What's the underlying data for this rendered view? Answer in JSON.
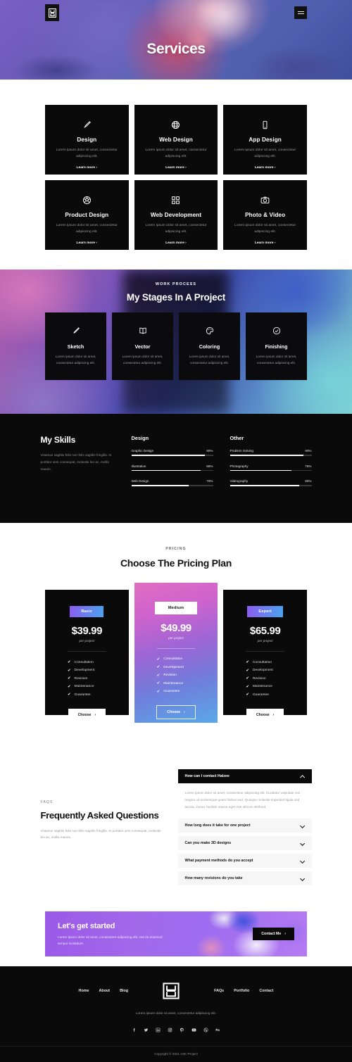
{
  "brand": {
    "name": "Halzee",
    "logo_icon": "h-monogram-logo"
  },
  "hero": {
    "title": "Services",
    "menu_icon": "hamburger-menu-icon"
  },
  "services": {
    "cards": [
      {
        "icon": "brush-icon",
        "title": "Design",
        "desc": "Lorem ipsum dolor sit amet, consectetur adipiscing elit.",
        "link": "Learn more"
      },
      {
        "icon": "globe-icon",
        "title": "Web Design",
        "desc": "Lorem ipsum dolor sit amet, consectetur adipiscing elit.",
        "link": "Learn more"
      },
      {
        "icon": "mobile-icon",
        "title": "App Design",
        "desc": "Lorem ipsum dolor sit amet, consectetur adipiscing elit.",
        "link": "Learn more"
      },
      {
        "icon": "soccer-ball-icon",
        "title": "Product Design",
        "desc": "Lorem ipsum dolor sit amet, consectetur adipiscing elit.",
        "link": "Learn more"
      },
      {
        "icon": "grid-squares-icon",
        "title": "Web Development",
        "desc": "Lorem ipsum dolor sit amet, consectetur adipiscing elit.",
        "link": "Learn more"
      },
      {
        "icon": "camera-icon",
        "title": "Photo & Video",
        "desc": "Lorem ipsum dolor sit amet, consectetur adipiscing elit.",
        "link": "Learn more"
      }
    ]
  },
  "process": {
    "label": "WORK PROCESS",
    "title": "My Stages In A Project",
    "cards": [
      {
        "icon": "pencil-icon",
        "title": "Sketch",
        "desc": "Lorem ipsum dolor sit amet, consectetur adipiscing elit."
      },
      {
        "icon": "open-book-icon",
        "title": "Vector",
        "desc": "Lorem ipsum dolor sit amet, consectetur adipiscing elit."
      },
      {
        "icon": "palette-icon",
        "title": "Coloring",
        "desc": "Lorem ipsum dolor sit amet, consectetur adipiscing elit."
      },
      {
        "icon": "check-circle-icon",
        "title": "Finishing",
        "desc": "Lorem ipsum dolor sit amet, consectetur adipiscing elit."
      }
    ]
  },
  "skills": {
    "heading": "My Skills",
    "description": "Vivamus sagittis felis non felis sagittis fringilla. In porttitor sem consequat, molestie leo ac, mollis mauris.",
    "columns": [
      {
        "title": "Design",
        "items": [
          {
            "label": "Graphic Design",
            "value": "90%",
            "pct": 90
          },
          {
            "label": "Illustration",
            "value": "85%",
            "pct": 85
          },
          {
            "label": "Web Design",
            "value": "70%",
            "pct": 70
          }
        ]
      },
      {
        "title": "Other",
        "items": [
          {
            "label": "Problem Solving",
            "value": "90%",
            "pct": 90
          },
          {
            "label": "Photography",
            "value": "75%",
            "pct": 75
          },
          {
            "label": "Videography",
            "value": "85%",
            "pct": 85
          }
        ]
      }
    ]
  },
  "pricing": {
    "label": "PRICING",
    "title": "Choose The Pricing Plan",
    "per_project": "per project",
    "choose_label": "Choose",
    "plans": [
      {
        "badge": "Basic",
        "price": "$39.99",
        "featured": false,
        "features": [
          "Consultation",
          "Development",
          "Revision",
          "Maintenance",
          "Guarantee"
        ]
      },
      {
        "badge": "Medium",
        "price": "$49.99",
        "featured": true,
        "features": [
          "Consultation",
          "Development",
          "Revision",
          "Maintenance",
          "Guarantee"
        ]
      },
      {
        "badge": "Expert",
        "price": "$65.99",
        "featured": false,
        "features": [
          "Consultation",
          "Development",
          "Revision",
          "Maintenance",
          "Guarantee"
        ]
      }
    ]
  },
  "faq": {
    "label": "FAQS",
    "heading": "Frequently Asked Questions",
    "sub": "Vivamus sagittis felis non felis sagittis fringilla. In porttitor sem consequat, molestie leo ac, mollis mauris.",
    "items": [
      {
        "question": "How can I contact Halzee",
        "answer": "Lorem ipsum dolor sit amet, consectetur adipiscing elit. Curabitur vulputate nisl magna, id scelerisque quam finibus sed. Quisque molestie imperdiet ligula sed lacinia. Donec facilisis massa eget erat ultrices eleifend.",
        "open": true
      },
      {
        "question": "How long does it take for one project",
        "answer": "",
        "open": false
      },
      {
        "question": "Can you make 3D designs",
        "answer": "",
        "open": false
      },
      {
        "question": "What payment methods do you accept",
        "answer": "",
        "open": false
      },
      {
        "question": "How many revisions do you take",
        "answer": "",
        "open": false
      }
    ]
  },
  "cta": {
    "title": "Let's get started",
    "sub": "Lorem ipsum dolor sit amet, consectetur adipiscing elit, sed do eiusmod tempor incididunt.",
    "button": "Contact Me"
  },
  "footer": {
    "nav_left": [
      "Home",
      "About",
      "Blog"
    ],
    "nav_right": [
      "FAQs",
      "Portfolio",
      "Contact"
    ],
    "description": "Lorem ipsum dolor sit amet, consectetur adipiscing elit.",
    "socials": [
      "facebook-icon",
      "twitter-icon",
      "linkedin-icon",
      "instagram-icon",
      "pinterest-icon",
      "youtube-icon",
      "dribbble-icon",
      "behance-icon"
    ],
    "copyright": "Copyright © 2021 ASK Project"
  },
  "colors": {
    "dark": "#0a0a0a",
    "accent_purple": "#8b5cf0",
    "accent_blue": "#4aa3ef",
    "cta_purple": "#9b59e8"
  }
}
